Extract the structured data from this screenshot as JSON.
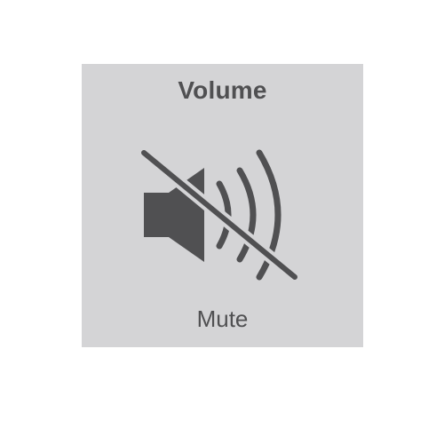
{
  "hud": {
    "title": "Volume",
    "status": "Mute",
    "icon": "speaker-muted-icon",
    "background_color": "#d4d4d6",
    "foreground_color": "#505052"
  }
}
